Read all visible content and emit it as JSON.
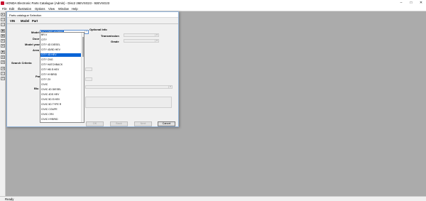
{
  "window": {
    "title": "HONDA Electronic Parts Catalogue (Admin) - Disc2 26EVSG23 - 92EVSG23",
    "minimize_label": "–",
    "maximize_label": "□",
    "close_label": "✕"
  },
  "menu": [
    "File",
    "Edit",
    "Illustration",
    "Options",
    "View",
    "Window",
    "Help"
  ],
  "toolbar": {
    "icons": [
      "open-icon",
      "print-icon",
      "folder-icon",
      "grid-icon",
      "book-icon",
      "list-icon",
      "users-icon",
      "settings-icon",
      "search-icon",
      "arrow-icon",
      "export-icon",
      "info-icon",
      "help-icon"
    ]
  },
  "dialog": {
    "title": "Parts catalogue Selection",
    "tabs": [
      "VIN",
      "Model",
      "Part"
    ],
    "labels": {
      "model": "Model",
      "door": "Door",
      "model_year": "Model year",
      "area": "Area",
      "search_criteria": "Search Criteria",
      "par": "Par",
      "blu": "Blu",
      "optional_info": "Optional Info",
      "transmission": "Transmission",
      "grade": "Grade"
    },
    "model_value": "ACCORD HYBRID",
    "model_options": [
      "BR-V",
      "CITY",
      "CITY 4D DIESEL",
      "CITY 4D/5D HEV",
      "CITY 4D HEV",
      "CITY CNG",
      "CITY HATCHBACK",
      "CITY HB E:HEV",
      "CITY HYBRID",
      "CITY ZX",
      "CIVIC",
      "CIVIC 4D DIESEL",
      "CIVIC 4DS HEV",
      "CIVIC 5D E:HEV",
      "CIVIC 5D TYPE R",
      "CIVIC COUPE",
      "CIVIC CRX",
      "CIVIC HYBRID"
    ],
    "selected_option": "CITY 4D HEV",
    "buttons": {
      "ok": "OK",
      "back": "Back",
      "next": "Next",
      "cancel": "Cancel"
    }
  },
  "statusbar": {
    "text": "Ready"
  },
  "colors": {
    "selection": "#0a64d6",
    "desktop": "#ababab",
    "dialog_bg": "#f0f0f0"
  }
}
